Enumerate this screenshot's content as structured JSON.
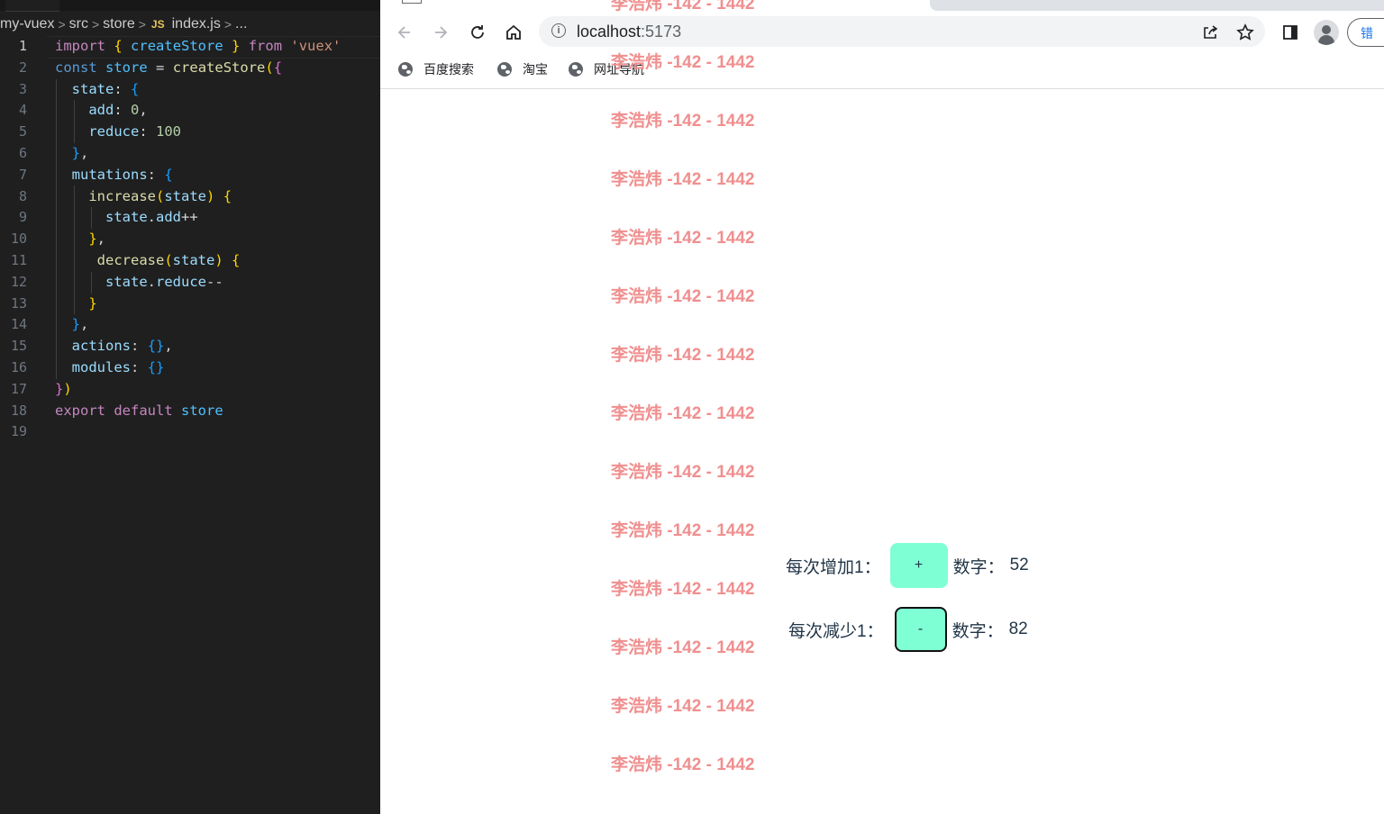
{
  "editor": {
    "breadcrumb": [
      "my-vuex",
      "src",
      "store",
      "index.js",
      "..."
    ],
    "file_badge": "JS",
    "active_line": 1,
    "lines": [
      {
        "n": "1"
      },
      {
        "n": "2"
      },
      {
        "n": "3"
      },
      {
        "n": "4"
      },
      {
        "n": "5"
      },
      {
        "n": "6"
      },
      {
        "n": "7"
      },
      {
        "n": "8"
      },
      {
        "n": "9"
      },
      {
        "n": "10"
      },
      {
        "n": "11"
      },
      {
        "n": "12"
      },
      {
        "n": "13"
      },
      {
        "n": "14"
      },
      {
        "n": "15"
      },
      {
        "n": "16"
      },
      {
        "n": "17"
      },
      {
        "n": "18"
      },
      {
        "n": "19"
      }
    ],
    "code": {
      "l1": [
        "import",
        "{",
        "createStore",
        "}",
        "from",
        "'vuex'"
      ],
      "l2": [
        "const",
        "store",
        "=",
        "createStore",
        "(",
        "{"
      ],
      "l3": [
        "state",
        ":",
        "{"
      ],
      "l4": [
        "add",
        ":",
        "0",
        ","
      ],
      "l5": [
        "reduce",
        ":",
        "100"
      ],
      "l6": [
        "}",
        ","
      ],
      "l7": [
        "mutations",
        ":",
        "{"
      ],
      "l8": [
        "increase",
        "(",
        "state",
        ")",
        "{"
      ],
      "l9": [
        "state",
        ".",
        "add",
        "++"
      ],
      "l10": [
        "}",
        ","
      ],
      "l11": [
        "decrease",
        "(",
        "state",
        ")",
        "{"
      ],
      "l12": [
        "state",
        ".",
        "reduce",
        "--"
      ],
      "l13": [
        "}"
      ],
      "l14": [
        "}",
        ","
      ],
      "l15": [
        "actions",
        ":",
        "{}",
        ","
      ],
      "l16": [
        "modules",
        ":",
        "{}"
      ],
      "l17": [
        "}",
        ")"
      ],
      "l18": [
        "export",
        "default",
        "store"
      ]
    }
  },
  "browser": {
    "url_host": "localhost",
    "url_port": ":5173",
    "right_button_label": "错",
    "icons": {
      "back": "back-arrow-icon",
      "forward": "forward-arrow-icon",
      "reload": "reload-icon",
      "home": "home-icon",
      "info": "info-icon",
      "share": "share-icon",
      "star": "star-icon",
      "sidepanel": "side-panel-icon",
      "profile": "profile-icon"
    },
    "bookmarks": [
      {
        "label": "百度搜索"
      },
      {
        "label": "淘宝"
      },
      {
        "label": "网址导航"
      }
    ]
  },
  "page": {
    "watermark_text": "李浩炜 -142 - 1442",
    "watermark_rows": 14,
    "increase": {
      "label": "每次增加1：",
      "button": "+",
      "count_label": "数字：",
      "count": "52"
    },
    "decrease": {
      "label": "每次减少1：",
      "button": "-",
      "count_label": "数字：",
      "count": "82"
    },
    "colors": {
      "watermark": "#f08f8f",
      "button": "#7fffd4",
      "text": "#213547"
    }
  }
}
